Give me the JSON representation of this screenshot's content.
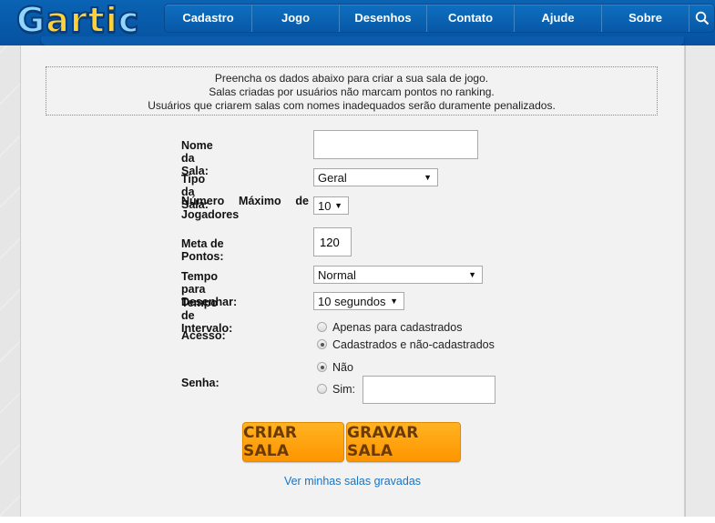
{
  "header": {
    "logo": "Gartic",
    "nav": [
      "Cadastro",
      "Jogo",
      "Desenhos",
      "Contato",
      "Ajude",
      "Sobre"
    ],
    "search_icon": "search-icon"
  },
  "notice": {
    "lines": [
      "Preencha os dados abaixo para criar a sua sala de jogo.",
      "Salas criadas por usuários não marcam pontos no ranking.",
      "Usuários que criarem salas com nomes inadequados serão duramente penalizados."
    ]
  },
  "form": {
    "room_name": {
      "label": "Nome da Sala:",
      "value": ""
    },
    "room_type": {
      "label": "Tipo da Sala:",
      "value": "Geral"
    },
    "max_players": {
      "label": "Número Máximo de Jogadores",
      "value": "10"
    },
    "points_goal": {
      "label": "Meta de Pontos:",
      "value": "120"
    },
    "draw_time": {
      "label": "Tempo para Desenhar:",
      "value": "Normal"
    },
    "interval_time": {
      "label": "Tempo de Intervalo:",
      "value": "10 segundos"
    },
    "access": {
      "label": "Acesso:",
      "options": [
        "Apenas para cadastrados",
        "Cadastrados e não-cadastrados"
      ],
      "selected": 1
    },
    "password": {
      "label": "Senha:",
      "options": [
        "Não",
        "Sim:"
      ],
      "selected": 0,
      "value": ""
    }
  },
  "buttons": {
    "create": "CRIAR SALA",
    "save": "GRAVAR SALA"
  },
  "links": {
    "saved_rooms": "Ver minhas salas gravadas"
  }
}
